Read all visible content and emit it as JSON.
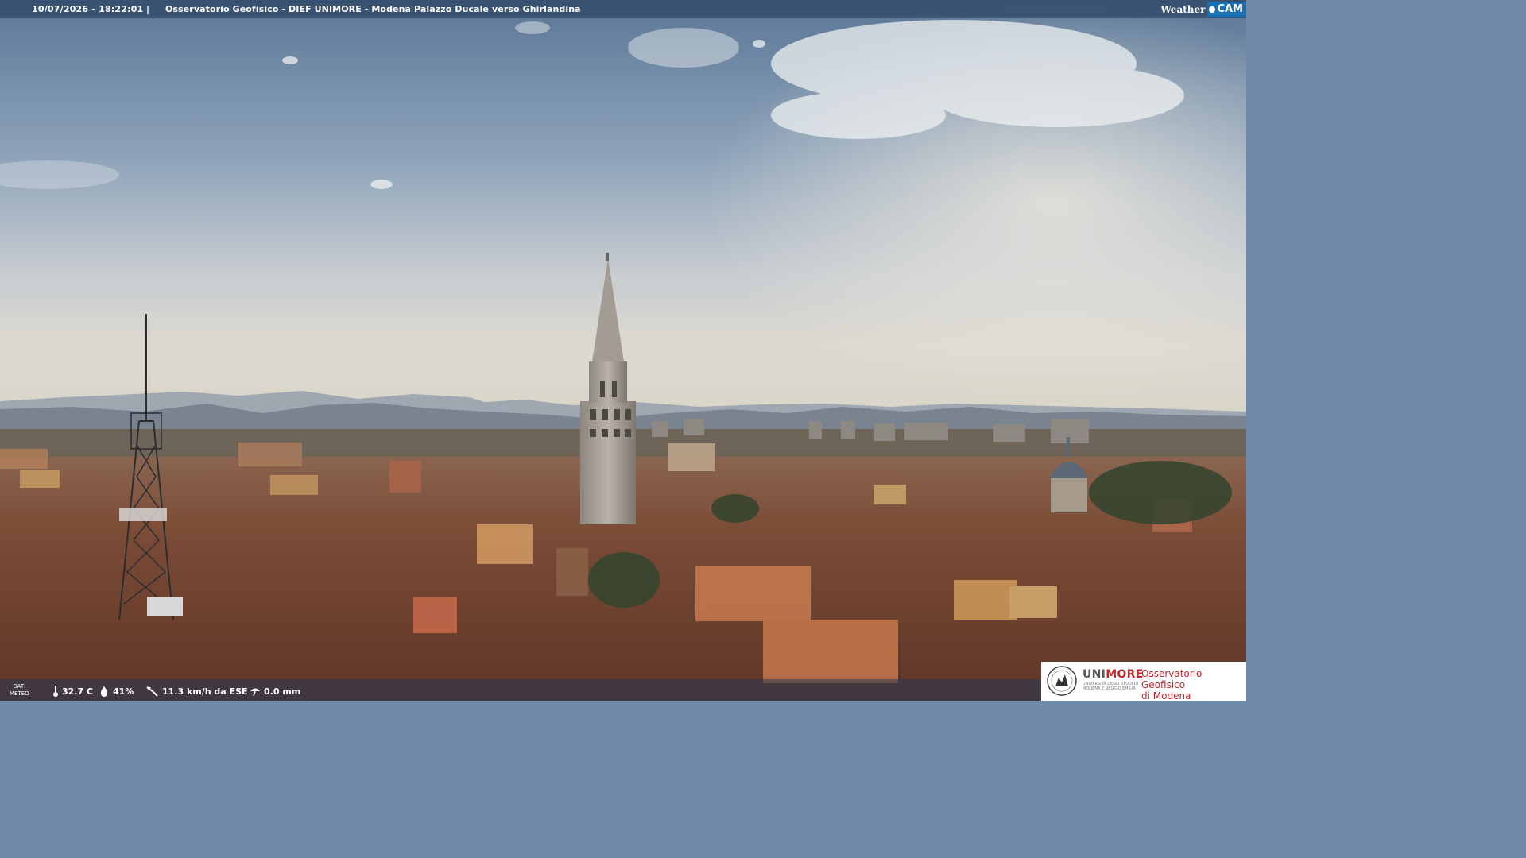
{
  "overlay": {
    "datetime": "10/07/2026 - 18:22:01",
    "separator": "|",
    "title": "Osservatorio Geofisico - DIEF UNIMORE - Modena Palazzo Ducale verso Ghirlandina",
    "brand_weather": "Weather",
    "brand_cam": "CAM"
  },
  "meteo": {
    "label_line1": "DATI",
    "label_line2": "METEO",
    "temperature": "32.7 C",
    "humidity": "41%",
    "wind": "11.3 km/h da ESE",
    "rain": "0.0 mm"
  },
  "logo": {
    "uni_a": "UNI",
    "uni_b": "MORE",
    "uni_sub1": "UNIVERSITÀ DEGLI STUDI DI",
    "uni_sub2": "MODENA E REGGIO EMILIA",
    "obs_line1": "Osservatorio Geofisico",
    "obs_line2": "di Modena"
  },
  "colors": {
    "sky_top": "#5f7d9e",
    "sky_mid": "#9fb0c2",
    "haze": "#d9d8d0",
    "roofs": "#7a4a34",
    "accent": "#c1272d",
    "cam_blue": "#1d6fb3"
  }
}
